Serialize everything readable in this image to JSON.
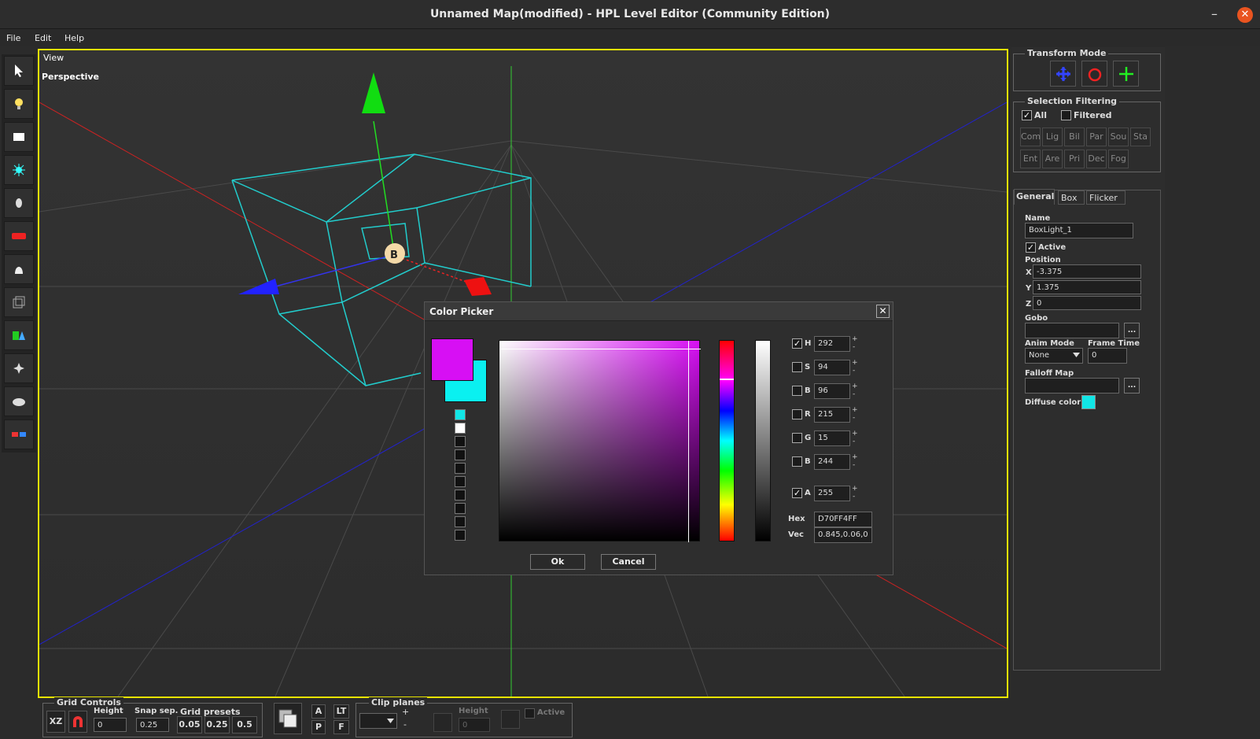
{
  "window": {
    "title": "Unnamed Map(modified) - HPL Level Editor (Community Edition)",
    "minimize": "–",
    "close": "✕"
  },
  "menu": {
    "file": "File",
    "edit": "Edit",
    "help": "Help"
  },
  "toolbar": {
    "icons": [
      "select-arrow-icon",
      "light-bulb-icon",
      "billboard-icon",
      "particle-icon",
      "sound-icon",
      "static-object-icon",
      "entity-icon",
      "area-icon",
      "primitive-icon",
      "decal-icon",
      "fog-icon",
      "combine-icon"
    ]
  },
  "viewport": {
    "label": "View",
    "mode": "Perspective"
  },
  "color_picker": {
    "title": "Color Picker",
    "close": "✕",
    "new_color": "#d70ff4",
    "old_color": "#0af0f0",
    "recent_swatches": [
      "#11e6e6",
      "#ffffff",
      "#111111",
      "#111111",
      "#111111",
      "#111111",
      "#111111",
      "#111111",
      "#111111",
      "#111111"
    ],
    "channels": [
      {
        "label": "H",
        "value": "292",
        "checked": true
      },
      {
        "label": "S",
        "value": "94",
        "checked": false
      },
      {
        "label": "B",
        "value": "96",
        "checked": false
      },
      {
        "label": "R",
        "value": "215",
        "checked": false
      },
      {
        "label": "G",
        "value": "15",
        "checked": false
      },
      {
        "label": "B",
        "value": "244",
        "checked": false
      },
      {
        "label": "A",
        "value": "255",
        "checked": true
      }
    ],
    "hex_label": "Hex",
    "hex_value": "D70FF4FF",
    "vec_label": "Vec",
    "vec_value": "0.845,0.06,0",
    "ok_label": "Ok",
    "cancel_label": "Cancel",
    "spin_up": "+",
    "spin_down": "-"
  },
  "transform_mode": {
    "title": "Transform Mode",
    "icons": [
      "translate-icon",
      "rotate-icon",
      "scale-icon"
    ]
  },
  "selection_filtering": {
    "title": "Selection Filtering",
    "all_label": "All",
    "all_checked": true,
    "filtered_label": "Filtered",
    "filtered_checked": false,
    "filters": [
      "Com",
      "Lig",
      "Bil",
      "Par",
      "Sou",
      "Sta",
      "Ent",
      "Are",
      "Pri",
      "Dec",
      "Fog"
    ]
  },
  "properties": {
    "tabs": [
      "General",
      "Box",
      "Flicker"
    ],
    "name_label": "Name",
    "name_value": "BoxLight_1",
    "active_label": "Active",
    "active_checked": true,
    "position_label": "Position",
    "x_label": "X",
    "x_value": "-3.375",
    "y_label": "Y",
    "y_value": "1.375",
    "z_label": "Z",
    "z_value": "0",
    "gobo_label": "Gobo",
    "gobo_value": "",
    "browse": "...",
    "anim_mode_label": "Anim Mode",
    "anim_mode_value": "None",
    "frame_time_label": "Frame Time",
    "frame_time_value": "0",
    "falloff_label": "Falloff Map",
    "falloff_value": "",
    "diffuse_label": "Diffuse color",
    "diffuse_color": "#11e6e6"
  },
  "grid_controls": {
    "title": "Grid Controls",
    "plane": "XZ",
    "height_label": "Height",
    "height_value": "0",
    "snap_label": "Snap sep.",
    "snap_value": "0.25",
    "presets_label": "Grid presets",
    "presets": [
      "0.05",
      "0.25",
      "0.5"
    ]
  },
  "view_buttons": {
    "a": "A",
    "p": "P",
    "lt": "LT",
    "f": "F"
  },
  "clip_planes": {
    "title": "Clip planes",
    "height_label": "Height",
    "height_value": "0",
    "active_label": "Active",
    "active_checked": false
  }
}
